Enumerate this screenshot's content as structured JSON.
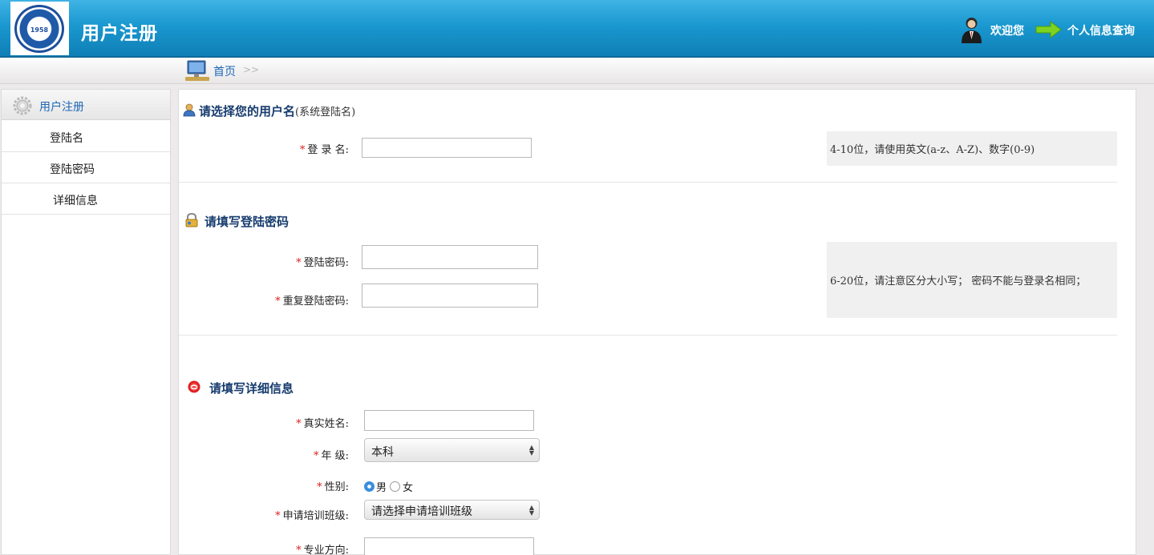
{
  "header": {
    "title": "用户注册",
    "welcome": "欢迎您",
    "info_link": "个人信息查询"
  },
  "breadcrumb": {
    "home": "首页",
    "separator": ">>"
  },
  "sidebar": {
    "heading": "用户注册",
    "items": [
      {
        "label": "登陆名"
      },
      {
        "label": "登陆密码"
      },
      {
        "label": "详细信息"
      }
    ]
  },
  "section_username": {
    "title": "请选择您的用户名",
    "subtitle": "(系统登陆名)",
    "login_label": "登 录 名:",
    "login_value": "",
    "hint": "4-10位，请使用英文(a-z、A-Z)、数字(0-9)"
  },
  "section_password": {
    "title": "请填写登陆密码",
    "password_label": "登陆密码:",
    "password_value": "",
    "repeat_label": "重复登陆密码:",
    "repeat_value": "",
    "hint": "6-20位，请注意区分大小写； 密码不能与登录名相同；"
  },
  "section_details": {
    "title": "请填写详细信息",
    "realname_label": "真实姓名:",
    "realname_value": "",
    "grade_label": "年 级:",
    "grade_selected": "本科",
    "gender_label": "性别:",
    "gender_options": [
      "男",
      "女"
    ],
    "gender_selected": "男",
    "class_label": "申请培训班级:",
    "class_selected": "请选择申请培训班级",
    "major_label": "专业方向:",
    "major_value": ""
  },
  "required_mark": "*",
  "colors": {
    "header_blue": "#1a98d0",
    "link_blue": "#1d67b7",
    "title_navy": "#173c6e",
    "required_red": "#d22222"
  }
}
